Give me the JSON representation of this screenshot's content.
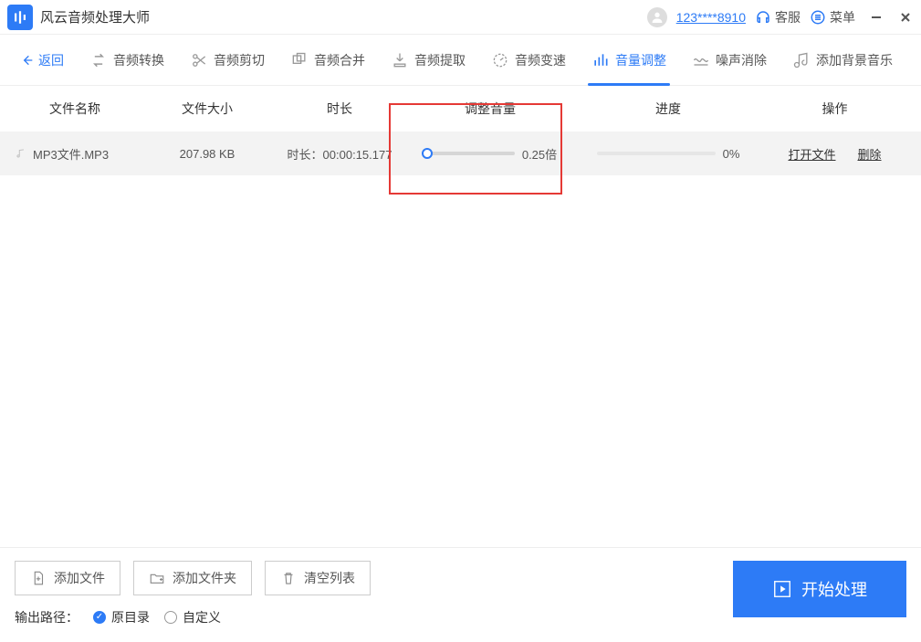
{
  "app": {
    "title": "风云音频处理大师"
  },
  "titlebar": {
    "user_id": "123****8910",
    "support": "客服",
    "menu": "菜单"
  },
  "toolbar": {
    "back": "返回",
    "tabs": [
      {
        "label": "音频转换"
      },
      {
        "label": "音频剪切"
      },
      {
        "label": "音频合并"
      },
      {
        "label": "音频提取"
      },
      {
        "label": "音频变速"
      },
      {
        "label": "音量调整"
      },
      {
        "label": "噪声消除"
      },
      {
        "label": "添加背景音乐"
      }
    ]
  },
  "columns": {
    "name": "文件名称",
    "size": "文件大小",
    "duration": "时长",
    "volume": "调整音量",
    "progress": "进度",
    "ops": "操作"
  },
  "row": {
    "filename": "MP3文件.MP3",
    "filesize": "207.98 KB",
    "duration_label": "时长：",
    "duration_value": "00:00:15.177",
    "volume_text": "0.25倍",
    "progress_text": "0%",
    "open_file": "打开文件",
    "delete": "删除"
  },
  "bottom": {
    "add_file": "添加文件",
    "add_folder": "添加文件夹",
    "clear_list": "清空列表",
    "start": "开始处理",
    "output_label": "输出路径：",
    "radio_original": "原目录",
    "radio_custom": "自定义"
  }
}
